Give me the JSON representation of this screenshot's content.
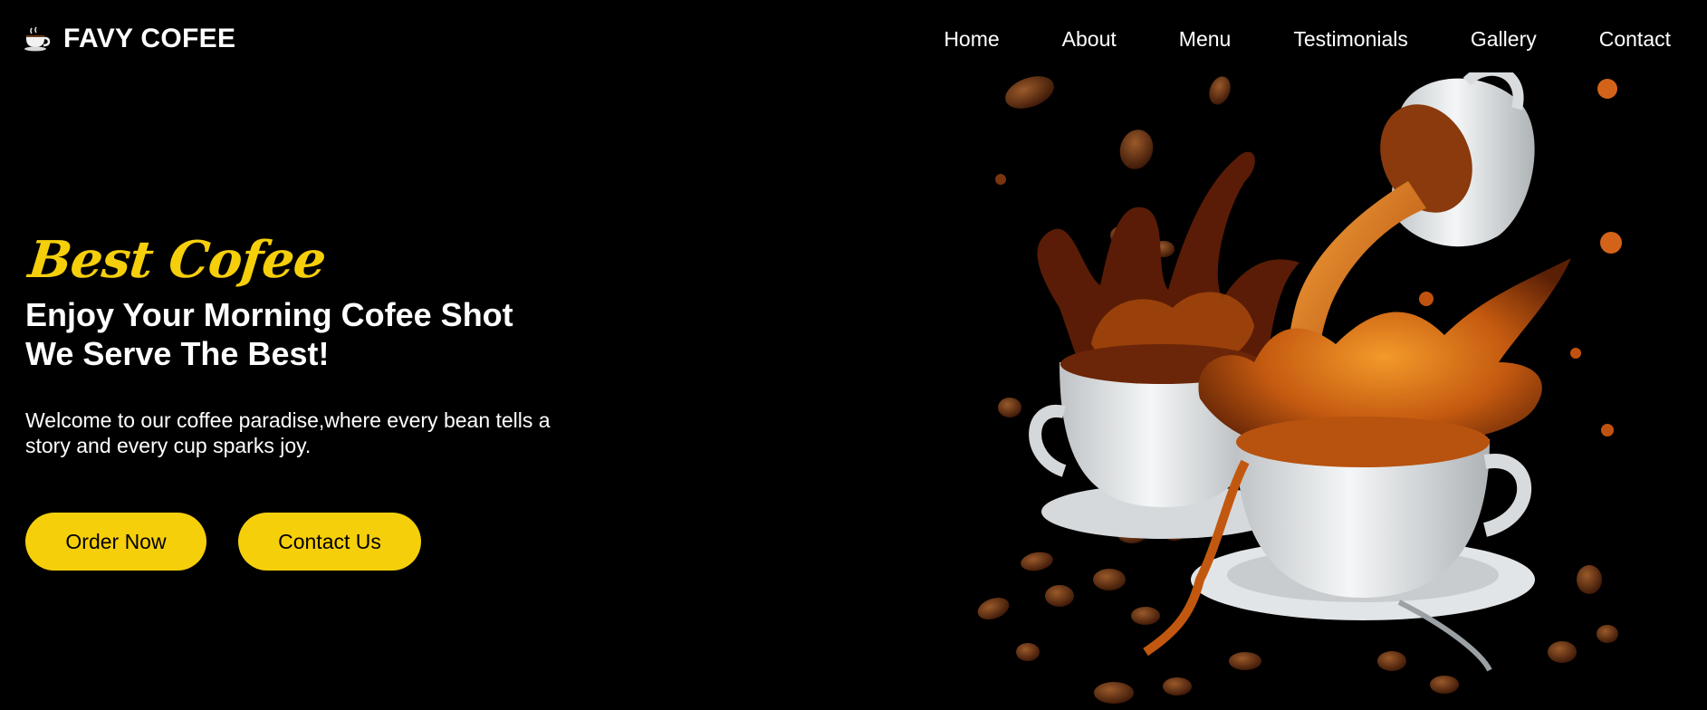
{
  "brand": {
    "name": "FAVY COFEE",
    "icon": "coffee-cup-icon"
  },
  "nav": {
    "items": [
      {
        "label": "Home"
      },
      {
        "label": "About"
      },
      {
        "label": "Menu"
      },
      {
        "label": "Testimonials"
      },
      {
        "label": "Gallery"
      },
      {
        "label": "Contact"
      }
    ]
  },
  "hero": {
    "tagline": "Best Cofee",
    "headline_line1": "Enjoy Your Morning Cofee Shot",
    "headline_line2": "We Serve The Best!",
    "description": "Welcome to our coffee paradise,where every bean tells a story and every cup sparks joy.",
    "order_button": "Order Now",
    "contact_button": "Contact Us",
    "image": "coffee-splash-illustration"
  },
  "colors": {
    "background": "#000000",
    "accent": "#f6cf0b",
    "text": "#ffffff",
    "coffee_dark": "#4a1d07",
    "coffee_mid": "#b24a0c",
    "coffee_light": "#f08a1c",
    "cup": "#e9ecee"
  }
}
